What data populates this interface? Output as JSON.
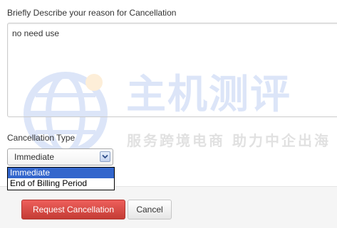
{
  "form": {
    "reason_label": "Briefly Describe your reason for Cancellation",
    "reason_value": "no need use",
    "type_label": "Cancellation Type",
    "type_selected": "Immediate",
    "type_options": [
      "Immediate",
      "End of Billing Period"
    ]
  },
  "footer": {
    "request_button": "Request Cancellation",
    "cancel_button": "Cancel"
  },
  "watermark": {
    "title": "主机测评",
    "subtitle": "服务跨境电商 助力中企出海"
  },
  "colors": {
    "request_button": "#d9534f",
    "selected_option": "#3366cc",
    "watermark": "#2a63d6"
  },
  "icons": {
    "select_arrow": "chevron-down-icon",
    "watermark_logo": "globe-icon"
  }
}
